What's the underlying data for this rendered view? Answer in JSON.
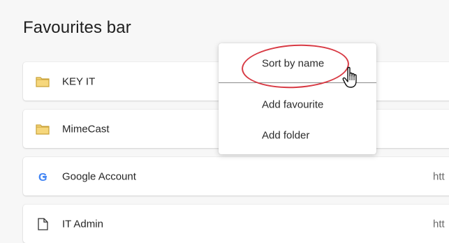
{
  "page": {
    "heading": "Favourites bar"
  },
  "favourites": [
    {
      "label": "KEY IT",
      "icon": "folder-icon",
      "url": ""
    },
    {
      "label": "MimeCast",
      "icon": "folder-icon",
      "url": ""
    },
    {
      "label": "Google Account",
      "icon": "google-icon",
      "url": "htt"
    },
    {
      "label": "IT Admin",
      "icon": "page-icon",
      "url": "htt"
    }
  ],
  "context_menu": {
    "items": [
      {
        "label": "Sort by name"
      },
      {
        "label": "Add favourite"
      },
      {
        "label": "Add folder"
      }
    ]
  },
  "colors": {
    "folder": "#e3bd4e",
    "annotation_ring": "#d83a44"
  }
}
